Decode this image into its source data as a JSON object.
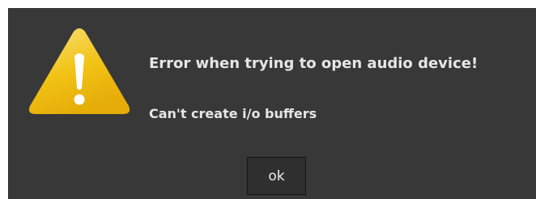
{
  "dialog": {
    "title": "Error when trying to open audio device!",
    "message": "Can't create i/o buffers",
    "ok_label": "ok",
    "icon": "warning-icon"
  },
  "colors": {
    "background": "#383838",
    "text": "#e6e6e6",
    "warning_yellow": "#f2c417",
    "warning_mark": "#ffffff"
  }
}
